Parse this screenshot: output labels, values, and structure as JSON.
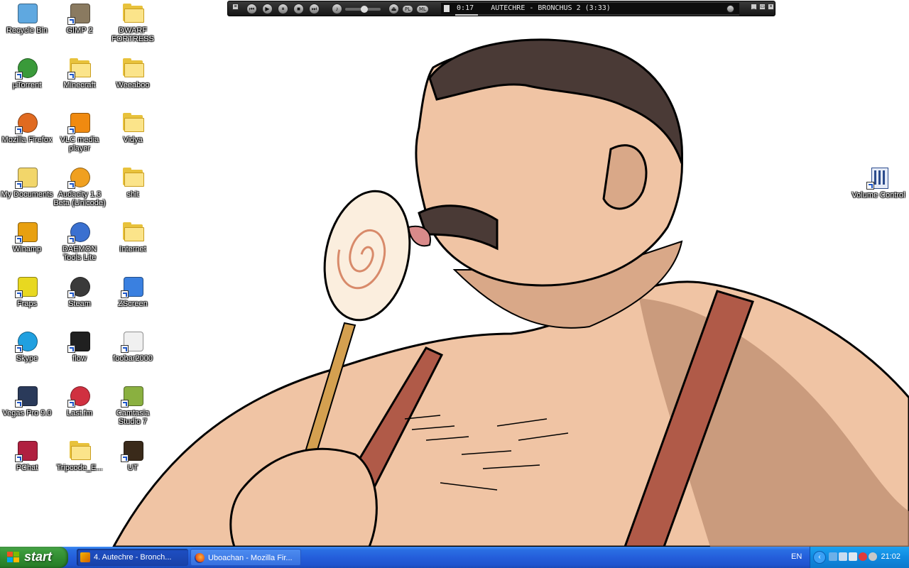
{
  "desktop": {
    "icons": [
      {
        "label": "Recycle Bin",
        "icon": "recycle-bin-icon",
        "shortcut": false
      },
      {
        "label": "GIMP 2",
        "icon": "gimp-icon",
        "shortcut": true
      },
      {
        "label": "DWARF FORTRESS",
        "icon": "folder-icon",
        "shortcut": false
      },
      {
        "label": "µTorrent",
        "icon": "utorrent-icon",
        "shortcut": true
      },
      {
        "label": "Minecraft",
        "icon": "folder-icon",
        "shortcut": true
      },
      {
        "label": "Weeaboo",
        "icon": "folder-icon",
        "shortcut": false
      },
      {
        "label": "Mozilla Firefox",
        "icon": "firefox-icon",
        "shortcut": true
      },
      {
        "label": "VLC media player",
        "icon": "vlc-icon",
        "shortcut": true
      },
      {
        "label": "Vidya",
        "icon": "folder-icon",
        "shortcut": false
      },
      {
        "label": "My Documents",
        "icon": "my-documents-icon",
        "shortcut": true
      },
      {
        "label": "Audacity 1.3 Beta (Unicode)",
        "icon": "audacity-icon",
        "shortcut": true
      },
      {
        "label": "shit",
        "icon": "folder-icon",
        "shortcut": false
      },
      {
        "label": "Winamp",
        "icon": "winamp-icon",
        "shortcut": true
      },
      {
        "label": "DAEMON Tools Lite",
        "icon": "daemon-tools-icon",
        "shortcut": true
      },
      {
        "label": "Internet",
        "icon": "folder-icon",
        "shortcut": false
      },
      {
        "label": "Fraps",
        "icon": "fraps-icon",
        "shortcut": true
      },
      {
        "label": "Steam",
        "icon": "steam-icon",
        "shortcut": true
      },
      {
        "label": "ZScreen",
        "icon": "zscreen-icon",
        "shortcut": true
      },
      {
        "label": "Skype",
        "icon": "skype-icon",
        "shortcut": true
      },
      {
        "label": "flow",
        "icon": "flow-icon",
        "shortcut": true
      },
      {
        "label": "foobar2000",
        "icon": "foobar2000-icon",
        "shortcut": true
      },
      {
        "label": "Vegas Pro 9.0",
        "icon": "vegas-pro-icon",
        "shortcut": true
      },
      {
        "label": "Last.fm",
        "icon": "lastfm-icon",
        "shortcut": true
      },
      {
        "label": "Camtasia Studio 7",
        "icon": "camtasia-icon",
        "shortcut": true
      },
      {
        "label": "PChat",
        "icon": "pchat-icon",
        "shortcut": true
      },
      {
        "label": "Tripcode_E...",
        "icon": "folder-icon",
        "shortcut": false
      },
      {
        "label": "UT",
        "icon": "unreal-tournament-icon",
        "shortcut": true
      }
    ],
    "right_icon": {
      "label": "Volume Control",
      "icon": "volume-control-icon"
    }
  },
  "winamp": {
    "display_time": "0:17",
    "track_title": "AUTECHRE - BRONCHUS 2 (3:33)",
    "pl_label": "PL",
    "ml_label": "ML",
    "volume_fraction": 0.55,
    "progress_fraction": 0.08
  },
  "taskbar": {
    "start_label": "start",
    "tasks": [
      {
        "label": "4. Autechre - Bronch...",
        "icon": "winamp-icon"
      },
      {
        "label": "Uboachan - Mozilla Fir...",
        "icon": "firefox-icon"
      }
    ],
    "language": "EN",
    "clock": "21:02"
  },
  "colors": {
    "taskbar_blue": "#245edb",
    "start_green": "#3c9a3c",
    "tray_blue": "#0f8ae0"
  }
}
